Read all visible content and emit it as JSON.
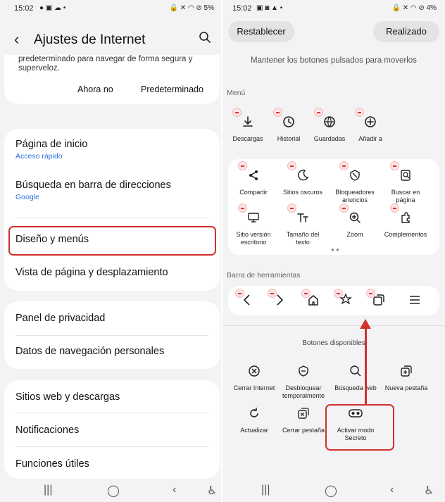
{
  "left": {
    "status": {
      "time": "15:02",
      "battery": "5%"
    },
    "header": {
      "title": "Ajustes de Internet"
    },
    "prompt": {
      "text": "predeterminado para navegar de forma segura y superveloz.",
      "not_now": "Ahora no",
      "default": "Predeterminado"
    },
    "group1": [
      {
        "title": "Página de inicio",
        "subtitle": "Acceso rápido"
      },
      {
        "title": "Búsqueda en barra de direcciones",
        "subtitle": "Google"
      },
      {
        "title": "Diseño y menús"
      },
      {
        "title": "Vista de página y desplazamiento"
      }
    ],
    "group2": [
      {
        "title": "Panel de privacidad"
      },
      {
        "title": "Datos de navegación personales"
      }
    ],
    "group3": [
      {
        "title": "Sitios web y descargas"
      },
      {
        "title": "Notificaciones"
      },
      {
        "title": "Funciones útiles"
      }
    ]
  },
  "right": {
    "status": {
      "time": "15:02",
      "battery": "4%"
    },
    "reset": "Restablecer",
    "done": "Realizado",
    "hint": "Mantener los botones pulsados para moverlos",
    "menu_label": "Menú",
    "menu_top": [
      {
        "label": "Descargas",
        "icon": "download-icon"
      },
      {
        "label": "Historial",
        "icon": "history-icon"
      },
      {
        "label": "Guardadas",
        "icon": "saved-globe-icon"
      },
      {
        "label": "Añadir a",
        "icon": "add-circle-icon"
      }
    ],
    "menu_grid": [
      {
        "label": "Compartir",
        "icon": "share-icon"
      },
      {
        "label": "Sitios oscuros",
        "icon": "moon-icon"
      },
      {
        "label": "Bloqueadores anuncios",
        "icon": "block-icon"
      },
      {
        "label": "Buscar en página",
        "icon": "find-in-page-icon"
      },
      {
        "label": "Sitio versión escritorio",
        "icon": "desktop-icon"
      },
      {
        "label": "Tamaño del texto",
        "icon": "text-size-icon"
      },
      {
        "label": "Zoom",
        "icon": "zoom-icon"
      },
      {
        "label": "Complementos",
        "icon": "addons-icon"
      }
    ],
    "toolbar_label": "Barra de herramientas",
    "available_label": "Botones disponibles",
    "available": [
      {
        "label": "Cerrar Internet",
        "icon": "close-circle-icon"
      },
      {
        "label": "Desbloquear temporalmente",
        "icon": "unlock-shield-icon"
      },
      {
        "label": "Búsqueda web",
        "icon": "search-icon"
      },
      {
        "label": "Nueva pestaña",
        "icon": "new-tab-icon"
      },
      {
        "label": "Actualizar",
        "icon": "refresh-icon"
      },
      {
        "label": "Cerrar pestaña",
        "icon": "close-tab-icon"
      },
      {
        "label": "Activar modo Secreto",
        "icon": "secret-mode-icon"
      }
    ]
  },
  "colors": {
    "highlight": "#d0312d",
    "link": "#2b6fd6",
    "background": "#f3f3f5"
  }
}
